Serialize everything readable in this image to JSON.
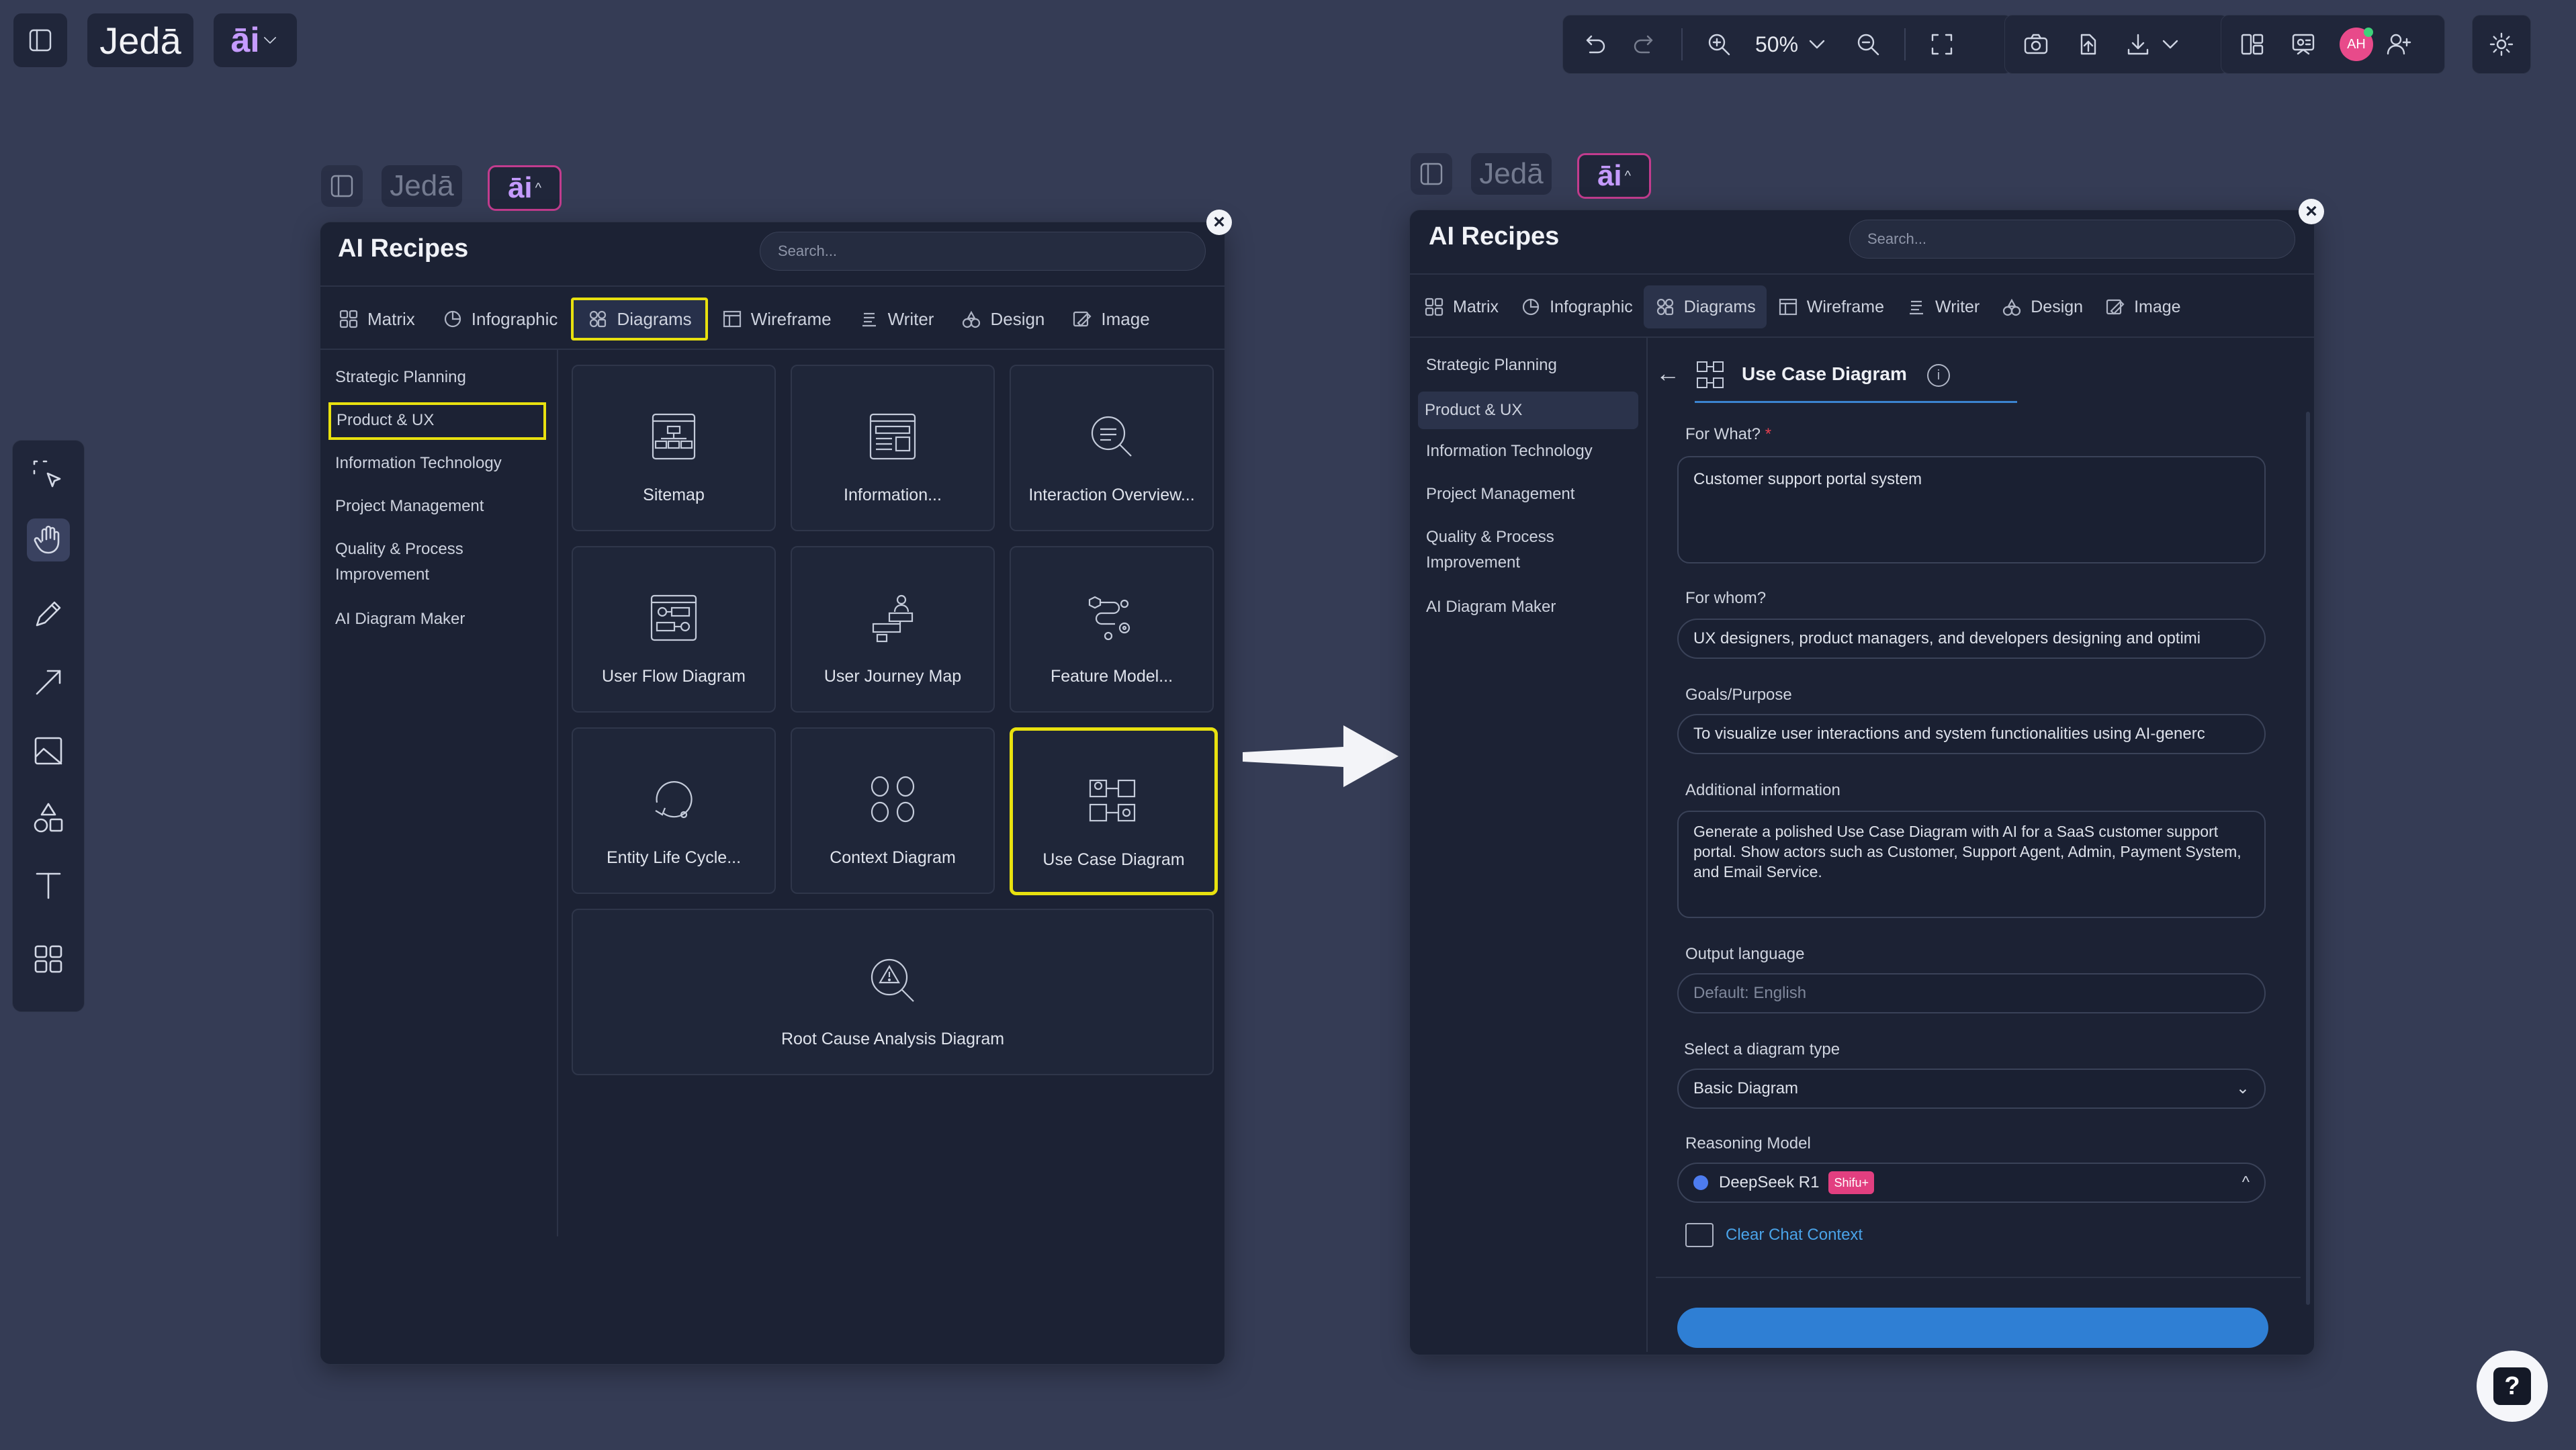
{
  "app": {
    "brand": "Jedā",
    "ai_label": "āi",
    "zoom": "50%",
    "avatar_initials": "AH"
  },
  "colors": {
    "background": "#353c55",
    "panel": "#1c2234",
    "highlight": "#e8e10f",
    "avatar": "#e84a8a",
    "link": "#4aa3e8",
    "primary_button": "#2f7fd4"
  },
  "left_panel": {
    "title": "AI Recipes",
    "search_placeholder": "Search...",
    "tabs": [
      {
        "label": "Matrix",
        "icon": "grid-icon"
      },
      {
        "label": "Infographic",
        "icon": "pie-icon"
      },
      {
        "label": "Diagrams",
        "icon": "diagram-icon"
      },
      {
        "label": "Wireframe",
        "icon": "wireframe-icon"
      },
      {
        "label": "Writer",
        "icon": "writer-icon"
      },
      {
        "label": "Design",
        "icon": "design-icon"
      },
      {
        "label": "Image",
        "icon": "image-icon"
      }
    ],
    "categories": [
      "Strategic Planning",
      "Product & UX",
      "Information Technology",
      "Project Management",
      "Quality & Process",
      "Improvement",
      "AI Diagram Maker"
    ],
    "cards": [
      {
        "label": "Sitemap",
        "icon": "sitemap-icon"
      },
      {
        "label": "Information...",
        "icon": "information-architecture-icon"
      },
      {
        "label": "Interaction Overview...",
        "icon": "interaction-overview-icon"
      },
      {
        "label": "User Flow Diagram",
        "icon": "user-flow-icon"
      },
      {
        "label": "User Journey Map",
        "icon": "journey-map-icon"
      },
      {
        "label": "Feature Model...",
        "icon": "feature-model-icon"
      },
      {
        "label": "Entity Life Cycle...",
        "icon": "life-cycle-icon"
      },
      {
        "label": "Context Diagram",
        "icon": "context-diagram-icon"
      },
      {
        "label": "Use Case Diagram",
        "icon": "use-case-icon"
      },
      {
        "label": "Root Cause Analysis Diagram",
        "icon": "root-cause-icon"
      }
    ]
  },
  "right_panel": {
    "title": "AI Recipes",
    "search_placeholder": "Search...",
    "tabs": [
      {
        "label": "Matrix"
      },
      {
        "label": "Infographic"
      },
      {
        "label": "Diagrams"
      },
      {
        "label": "Wireframe"
      },
      {
        "label": "Writer"
      },
      {
        "label": "Design"
      },
      {
        "label": "Image"
      }
    ],
    "categories": [
      "Strategic Planning",
      "Product & UX",
      "Information Technology",
      "Project Management",
      "Quality & Process",
      "Improvement",
      "AI Diagram Maker"
    ],
    "form": {
      "title": "Use Case Diagram",
      "for_what_label": "For What?",
      "required_mark": "*",
      "for_what_value": "Customer support portal system",
      "for_whom_label": "For whom?",
      "for_whom_value": "UX designers, product managers, and developers designing and optimi",
      "goals_label": "Goals/Purpose",
      "goals_value": "To visualize user interactions and system functionalities using AI-generc",
      "additional_label": "Additional information",
      "additional_value": "Generate a polished Use Case Diagram with AI for a SaaS customer support portal. Show actors such as Customer, Support Agent, Admin, Payment System, and Email Service.",
      "output_language_label": "Output language",
      "output_language_placeholder": "Default: English",
      "diagram_type_label": "Select a diagram type",
      "diagram_type_value": "Basic Diagram",
      "reasoning_label": "Reasoning Model",
      "reasoning_value": "DeepSeek R1",
      "reasoning_badge": "Shifu+",
      "clear_chat": "Clear Chat Context"
    }
  }
}
